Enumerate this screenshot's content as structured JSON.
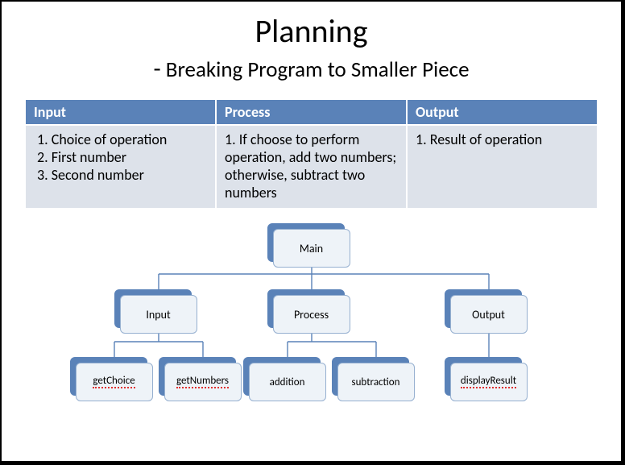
{
  "title": "Planning",
  "subtitle_dash": "-",
  "subtitle": "Breaking Program to Smaller Piece",
  "table": {
    "headers": {
      "input": "Input",
      "process": "Process",
      "output": "Output"
    },
    "input_items": [
      "1.  Choice of operation",
      "2.  First number",
      "3.  Second number"
    ],
    "process_text": "1. If choose to perform operation, add two numbers; otherwise, subtract two numbers",
    "output_text": "1. Result of operation"
  },
  "tree": {
    "root": "Main",
    "level1": {
      "input": "Input",
      "process": "Process",
      "output": "Output"
    },
    "leaves": {
      "getChoice": "getChoice",
      "getNumbers": "getNumbers",
      "addition": "addition",
      "subtraction": "subtraction",
      "displayResult": "displayResult"
    }
  }
}
